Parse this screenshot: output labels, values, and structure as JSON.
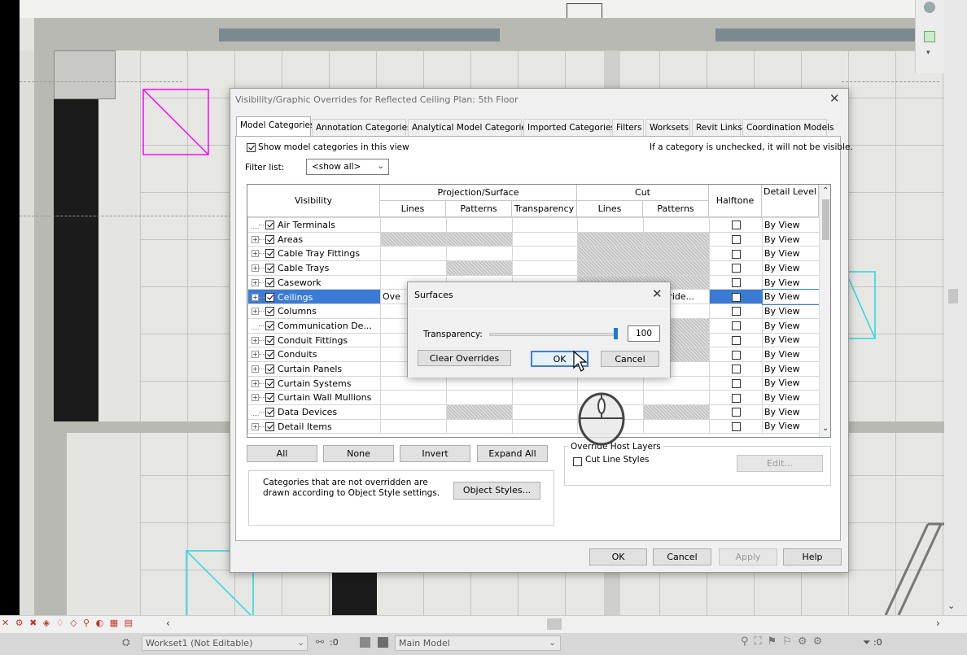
{
  "vg_dialog": {
    "title": "Visibility/Graphic Overrides for Reflected Ceiling Plan: 5th Floor",
    "tabs": [
      "Model Categories",
      "Annotation Categories",
      "Analytical Model Categories",
      "Imported Categories",
      "Filters",
      "Worksets",
      "Revit Links",
      "Coordination Models"
    ],
    "show_categories_label": "Show model categories in this view",
    "unchecked_note": "If a category is unchecked, it will not be visible.",
    "filter_label": "Filter list:",
    "filter_value": "<show all>",
    "headers": {
      "visibility": "Visibility",
      "projection": "Projection/Surface",
      "cut": "Cut",
      "lines": "Lines",
      "patterns": "Patterns",
      "transparency": "Transparency",
      "cut_lines": "Lines",
      "cut_patterns": "Patterns",
      "halftone": "Halftone",
      "detail_level": "Detail Level"
    },
    "rows": [
      {
        "name": "Air Terminals",
        "expand": false,
        "hatch": [
          0,
          0,
          0,
          0,
          0
        ],
        "detail": "By View"
      },
      {
        "name": "Areas",
        "expand": true,
        "hatch": [
          1,
          1,
          0,
          1,
          1
        ],
        "detail": "By View"
      },
      {
        "name": "Cable Tray Fittings",
        "expand": true,
        "hatch": [
          0,
          0,
          0,
          1,
          1
        ],
        "detail": "By View"
      },
      {
        "name": "Cable Trays",
        "expand": true,
        "hatch": [
          0,
          1,
          0,
          1,
          1
        ],
        "detail": "By View"
      },
      {
        "name": "Casework",
        "expand": true,
        "hatch": [
          0,
          0,
          0,
          1,
          1
        ],
        "detail": "By View"
      },
      {
        "name": "Ceilings",
        "expand": true,
        "hatch": [
          0,
          0,
          0,
          0,
          0
        ],
        "detail": "By View",
        "selected": true,
        "lines_text": "Ove",
        "cut_pattern_text": "rride..."
      },
      {
        "name": "Columns",
        "expand": true,
        "hatch": [
          0,
          0,
          0,
          0,
          0
        ],
        "detail": "By View"
      },
      {
        "name": "Communication De...",
        "expand": false,
        "hatch": [
          0,
          0,
          0,
          0,
          1
        ],
        "detail": "By View"
      },
      {
        "name": "Conduit Fittings",
        "expand": true,
        "hatch": [
          0,
          0,
          0,
          0,
          1
        ],
        "detail": "By View"
      },
      {
        "name": "Conduits",
        "expand": true,
        "hatch": [
          0,
          0,
          0,
          0,
          1
        ],
        "detail": "By View"
      },
      {
        "name": "Curtain Panels",
        "expand": true,
        "hatch": [
          0,
          0,
          0,
          0,
          0
        ],
        "detail": "By View"
      },
      {
        "name": "Curtain Systems",
        "expand": true,
        "hatch": [
          0,
          0,
          0,
          0,
          0
        ],
        "detail": "By View"
      },
      {
        "name": "Curtain Wall Mullions",
        "expand": true,
        "hatch": [
          0,
          0,
          0,
          0,
          0
        ],
        "detail": "By View"
      },
      {
        "name": "Data Devices",
        "expand": false,
        "hatch": [
          0,
          1,
          0,
          0,
          1
        ],
        "detail": "By View"
      },
      {
        "name": "Detail Items",
        "expand": true,
        "hatch": [
          0,
          0,
          0,
          0,
          0
        ],
        "detail": "By View"
      }
    ],
    "buttons": {
      "all": "All",
      "none": "None",
      "invert": "Invert",
      "expand_all": "Expand All",
      "object_styles": "Object Styles...",
      "edit": "Edit...",
      "ok": "OK",
      "cancel": "Cancel",
      "apply": "Apply",
      "help": "Help"
    },
    "override_host_layers": "Override Host Layers",
    "cut_line_styles": "Cut Line Styles",
    "object_style_note": "Categories that are not overridden are drawn according to Object Style settings."
  },
  "surfaces_dialog": {
    "title": "Surfaces",
    "transparency_label": "Transparency:",
    "transparency_value": "100",
    "transparency_fraction": 1.0,
    "clear_overrides": "Clear Overrides",
    "ok": "OK",
    "cancel": "Cancel"
  },
  "statusbar": {
    "workset": "Workset1 (Not Editable)",
    "workset_count": ":0",
    "model": "Main Model",
    "filter_count": ":0"
  }
}
